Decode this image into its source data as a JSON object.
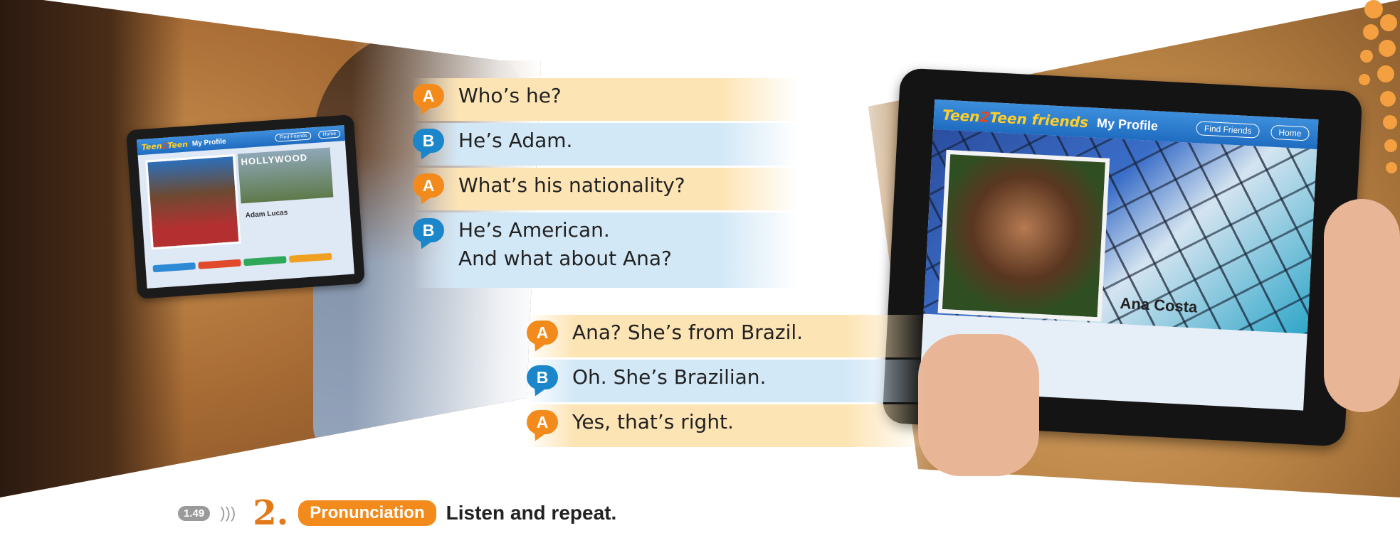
{
  "left_tablet": {
    "logo_a": "Teen",
    "logo_b": "2",
    "logo_c": "Teen",
    "title": "My Profile",
    "btn_find": "Find Friends",
    "btn_home": "Home",
    "banner": "HOLLYWOOD",
    "name": "Adam Lucas"
  },
  "right_tablet": {
    "logo_a": "Teen",
    "logo_b": "2",
    "logo_c": "Teen friends",
    "title": "My Profile",
    "btn_find": "Find Friends",
    "btn_home": "Home",
    "name": "Ana Costa"
  },
  "dialogue": [
    {
      "speaker": "A",
      "text": "Who’s he?"
    },
    {
      "speaker": "B",
      "text": "He’s Adam."
    },
    {
      "speaker": "A",
      "text": "What’s his nationality?"
    },
    {
      "speaker": "B",
      "text": "He’s American."
    },
    {
      "speaker": "B",
      "text": "And what about Ana?"
    },
    {
      "speaker": "A",
      "text": "Ana? She’s from Brazil."
    },
    {
      "speaker": "B",
      "text": "Oh. She’s Brazilian."
    },
    {
      "speaker": "A",
      "text": "Yes, that’s right."
    }
  ],
  "exercise": {
    "track": "1.49",
    "number": "2.",
    "tag": "Pronunciation",
    "instruction": "Listen and repeat."
  },
  "colors": {
    "speaker_a": "#f28a1c",
    "speaker_b": "#1b86c9",
    "band_a": "#fde4b4",
    "band_b": "#d3e8f7"
  }
}
